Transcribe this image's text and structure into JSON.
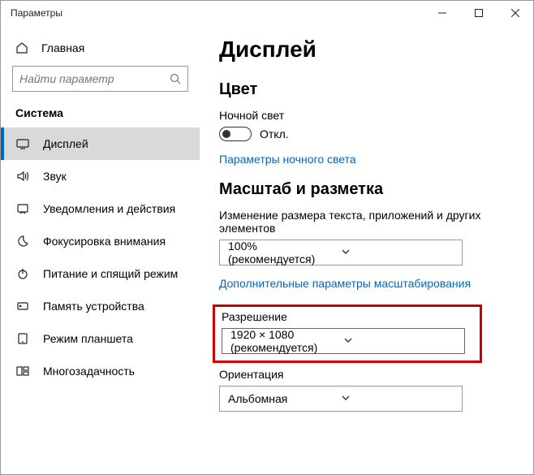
{
  "window": {
    "title": "Параметры"
  },
  "sidebar": {
    "home": "Главная",
    "search_placeholder": "Найти параметр",
    "group": "Система",
    "items": [
      {
        "label": "Дисплей"
      },
      {
        "label": "Звук"
      },
      {
        "label": "Уведомления и действия"
      },
      {
        "label": "Фокусировка внимания"
      },
      {
        "label": "Питание и спящий режим"
      },
      {
        "label": "Память устройства"
      },
      {
        "label": "Режим планшета"
      },
      {
        "label": "Многозадачность"
      }
    ]
  },
  "content": {
    "title": "Дисплей",
    "color_heading": "Цвет",
    "night_label": "Ночной свет",
    "toggle_state": "Откл.",
    "night_link": "Параметры ночного света",
    "scale_heading": "Масштаб и разметка",
    "scale_label": "Изменение размера текста, приложений и других элементов",
    "scale_value": "100% (рекомендуется)",
    "scale_link": "Дополнительные параметры масштабирования",
    "resolution_label": "Разрешение",
    "resolution_value": "1920 × 1080 (рекомендуется)",
    "orientation_label": "Ориентация",
    "orientation_value": "Альбомная"
  }
}
